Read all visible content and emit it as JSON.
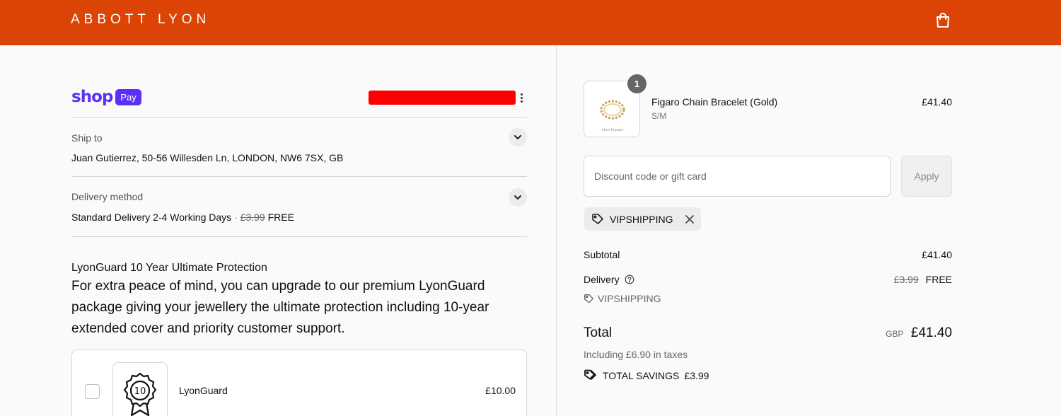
{
  "header": {
    "brand": "ABBOTT LYON",
    "cart_icon": "shopping-bag-icon",
    "brand_color": "#dc4405"
  },
  "shop_pay": {
    "shop_text": "shop",
    "pay_text": "Pay",
    "color": "#5a31f4",
    "menu_icon": "kebab-menu-icon"
  },
  "ship_to": {
    "label": "Ship to",
    "value": "Juan Gutierrez, 50-56 Willesden Ln, LONDON, NW6 7SX, GB",
    "toggle_icon": "chevron-down-icon"
  },
  "delivery_method": {
    "label": "Delivery method",
    "name": "Standard Delivery 2-4 Working Days",
    "separator": "·",
    "original_price": "£3.99",
    "price": "FREE",
    "toggle_icon": "chevron-down-icon"
  },
  "lyonguard": {
    "title": "LyonGuard 10 Year Ultimate Protection",
    "description": "For extra peace of mind, you can upgrade to our premium LyonGuard package giving your jewellery the ultimate protection including 10-year extended cover and priority customer support.",
    "option": {
      "name": "LyonGuard",
      "price": "£10.00",
      "checked": false,
      "badge_number": "10",
      "icon": "award-ribbon-icon"
    }
  },
  "summary": {
    "product": {
      "name": "Figaro Chain Bracelet (Gold)",
      "variant": "S/M",
      "price": "£41.40",
      "quantity": "1",
      "thumb_caption": "- Most Popular -"
    },
    "discount": {
      "placeholder": "Discount code or gift card",
      "value": "",
      "apply_label": "Apply"
    },
    "applied_code": {
      "code": "VIPSHIPPING",
      "tag_icon": "tag-icon",
      "remove_icon": "close-icon"
    },
    "subtotal": {
      "label": "Subtotal",
      "value": "£41.40"
    },
    "delivery": {
      "label": "Delivery",
      "help_icon": "question-circle-icon",
      "original": "£3.99",
      "value": "FREE",
      "code": "VIPSHIPPING"
    },
    "total": {
      "label": "Total",
      "currency": "GBP",
      "value": "£41.40",
      "taxes": "Including £6.90 in taxes"
    },
    "savings": {
      "label": "TOTAL SAVINGS",
      "value": "£3.99",
      "icon": "tags-icon"
    }
  }
}
